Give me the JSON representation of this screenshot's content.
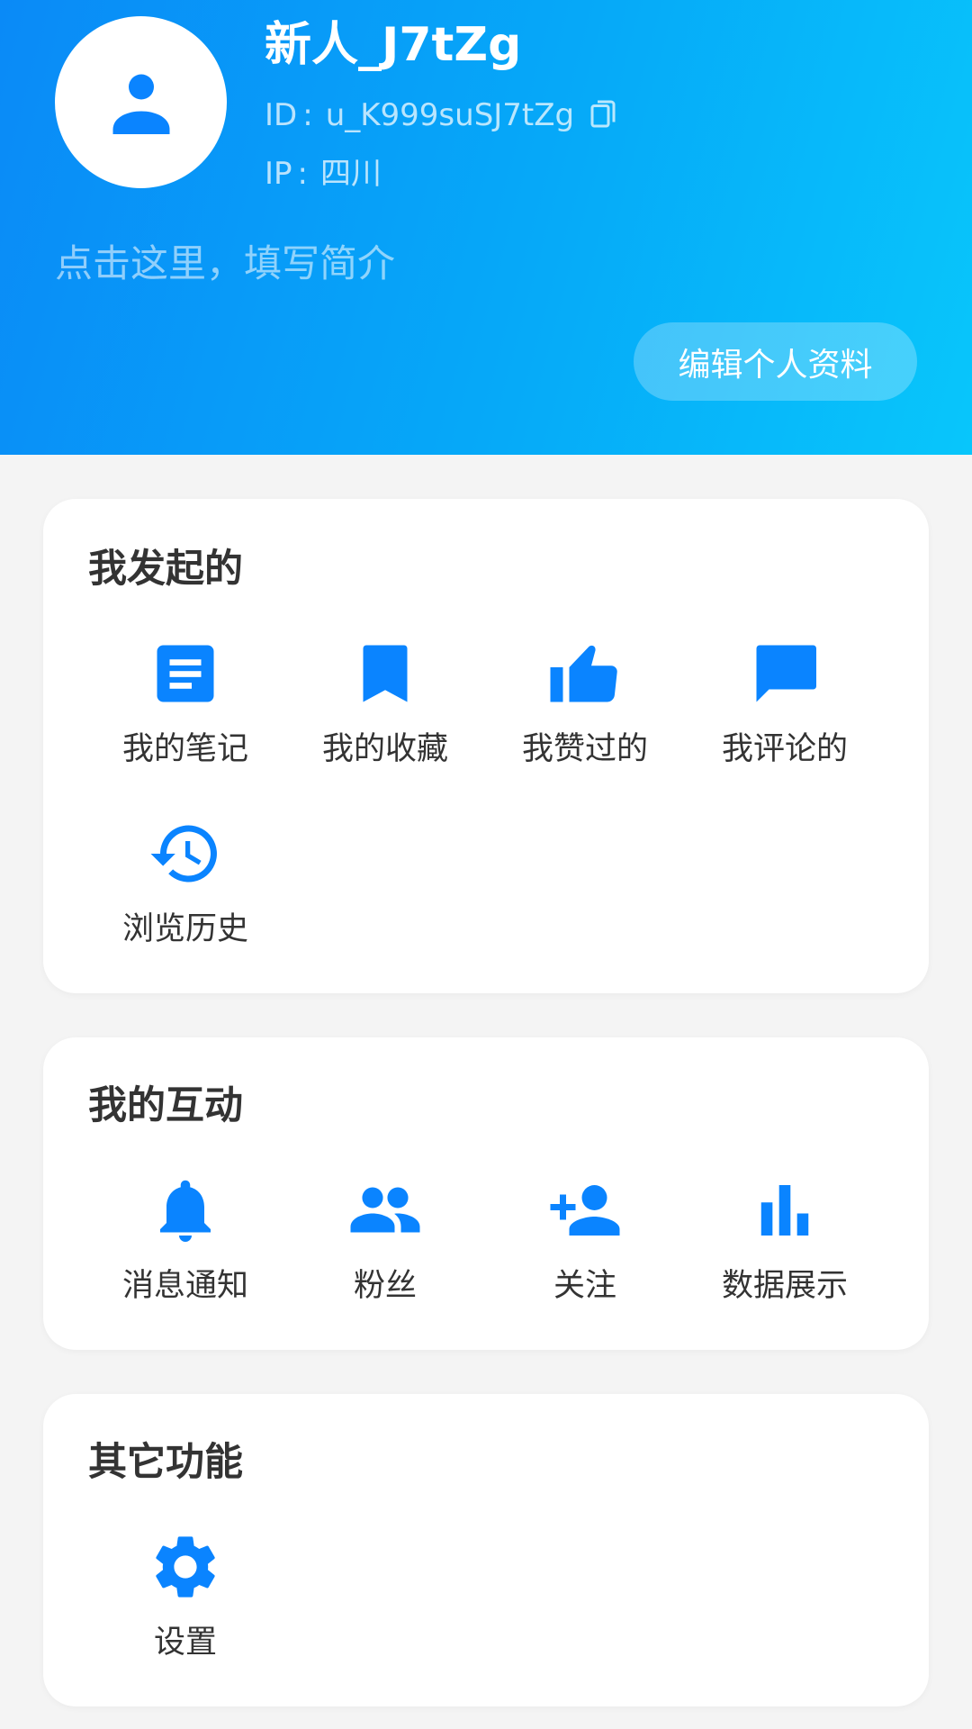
{
  "profile": {
    "username": "新人_J7tZg",
    "id_label": "ID",
    "id_sep": ":",
    "id_value": "u_K999suSJ7tZg",
    "ip_label": "IP",
    "ip_sep": ":",
    "ip_value": "四川",
    "bio_placeholder": "点击这里，填写简介",
    "edit_button": "编辑个人资料"
  },
  "sections": {
    "initiated": {
      "title": "我发起的",
      "items": [
        {
          "label": "我的笔记",
          "icon": "note-icon"
        },
        {
          "label": "我的收藏",
          "icon": "bookmark-icon"
        },
        {
          "label": "我赞过的",
          "icon": "thumb-up-icon"
        },
        {
          "label": "我评论的",
          "icon": "comment-icon"
        },
        {
          "label": "浏览历史",
          "icon": "history-icon"
        }
      ]
    },
    "interaction": {
      "title": "我的互动",
      "items": [
        {
          "label": "消息通知",
          "icon": "bell-icon"
        },
        {
          "label": "粉丝",
          "icon": "fans-icon"
        },
        {
          "label": "关注",
          "icon": "follow-icon"
        },
        {
          "label": "数据展示",
          "icon": "bar-chart-icon"
        }
      ]
    },
    "other": {
      "title": "其它功能",
      "items": [
        {
          "label": "设置",
          "icon": "gear-icon"
        }
      ]
    }
  },
  "colors": {
    "accent": "#0a84ff",
    "header_start": "#0a8af7",
    "header_end": "#08c6fb",
    "background": "#f4f4f4"
  }
}
